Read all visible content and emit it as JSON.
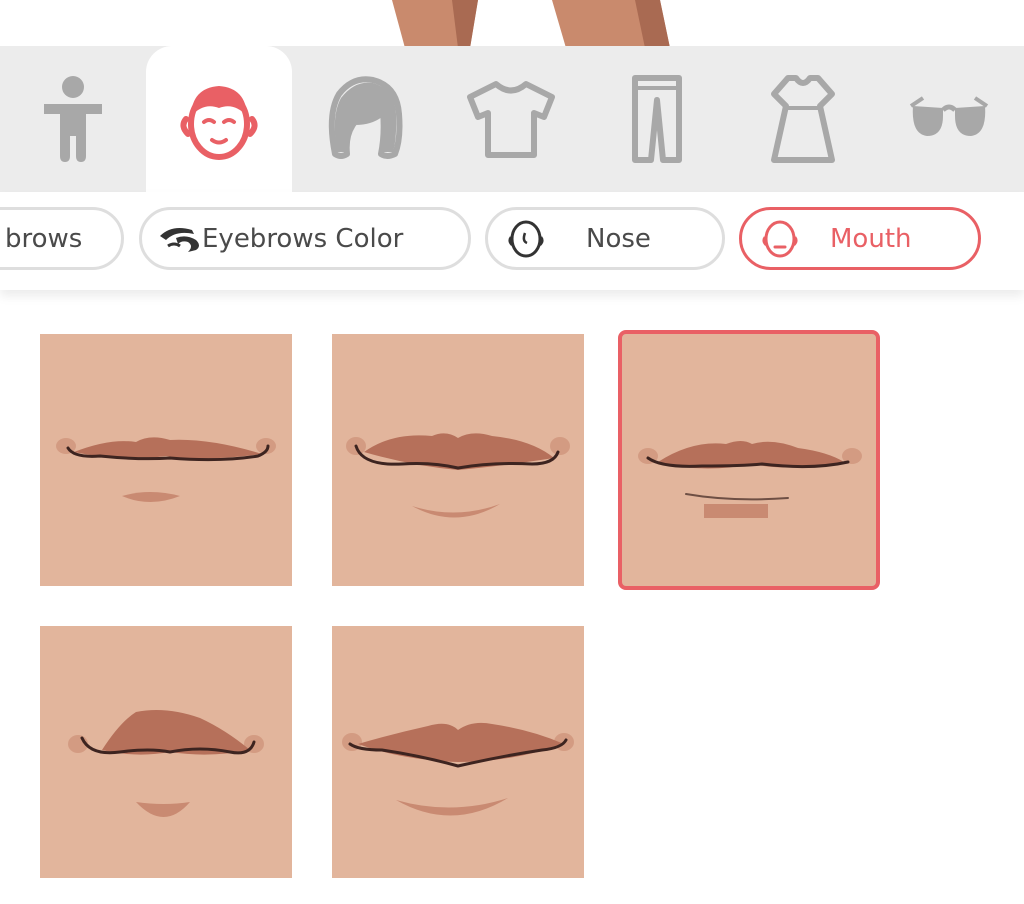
{
  "categories": [
    {
      "id": "body",
      "icon": "body-icon",
      "active": false
    },
    {
      "id": "face",
      "icon": "face-icon",
      "active": true
    },
    {
      "id": "hair",
      "icon": "hair-icon",
      "active": false
    },
    {
      "id": "tops",
      "icon": "tshirt-icon",
      "active": false
    },
    {
      "id": "bottoms",
      "icon": "pants-icon",
      "active": false
    },
    {
      "id": "dresses",
      "icon": "dress-icon",
      "active": false
    },
    {
      "id": "accessories",
      "icon": "sunglasses-icon",
      "active": false
    }
  ],
  "subcategories": {
    "eyebrows_label": "brows",
    "eyebrows_color_label": "Eyebrows Color",
    "nose_label": "Nose",
    "mouth_label": "Mouth",
    "selected": "Mouth"
  },
  "mouth_options": {
    "count": 5,
    "selected_index": 2
  },
  "colors": {
    "accent": "#e96065",
    "skin": "#e2b59c",
    "lip": "#b6705a",
    "lip_dark": "#3d2420",
    "inactive_icon": "#a8a8a8",
    "category_bg": "#ececec"
  }
}
